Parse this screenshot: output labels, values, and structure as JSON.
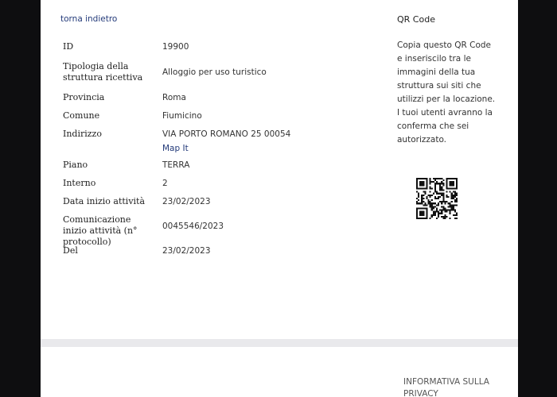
{
  "nav": {
    "back_label": "torna indietro"
  },
  "details": [
    {
      "label": "ID",
      "value": "19900"
    },
    {
      "label": "Tipologia della struttura ricettiva",
      "value": "Alloggio per uso turistico"
    },
    {
      "label": "Provincia",
      "value": "Roma"
    },
    {
      "label": "Comune",
      "value": "Fiumicino"
    },
    {
      "label": "Indirizzo",
      "value": "VIA PORTO ROMANO 25 00054",
      "link": "Map It"
    },
    {
      "label": "Piano",
      "value": "TERRA"
    },
    {
      "label": "Interno",
      "value": "2"
    },
    {
      "label": "Data inizio attività",
      "value": "23/02/2023"
    },
    {
      "label": "Comunicazione inizio attività (n° protocollo)",
      "value": "0045546/2023"
    },
    {
      "label": "Del",
      "value": "23/02/2023"
    }
  ],
  "qr": {
    "title": "QR Code",
    "description": "Copia questo QR Code e inseriscilo tra le immagini della tua struttura sui siti che utilizzi per la locazione. I tuoi utenti avranno la conferma che sei autorizzato.",
    "icon": "qr-code-image"
  },
  "footer": {
    "privacy_label": "INFORMATIVA SULLA PRIVACY"
  }
}
